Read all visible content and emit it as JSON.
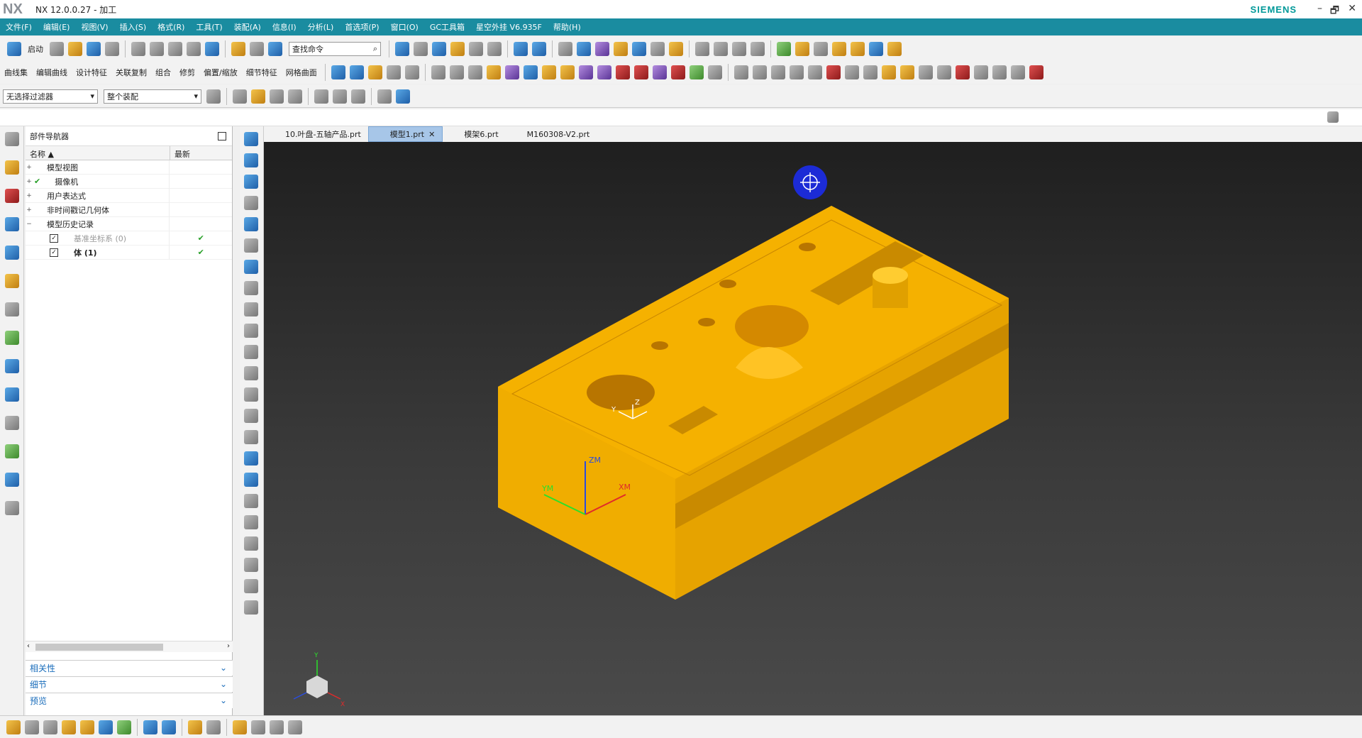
{
  "app": {
    "logo": "NX",
    "title": "NX 12.0.0.27 - 加工",
    "brand": "SIEMENS",
    "win_min": "–",
    "win_restore": "🗗",
    "win_close": "✕"
  },
  "menu": [
    "文件(F)",
    "编辑(E)",
    "视图(V)",
    "插入(S)",
    "格式(R)",
    "工具(T)",
    "装配(A)",
    "信息(I)",
    "分析(L)",
    "首选项(P)",
    "窗口(O)",
    "GC工具箱",
    "星空外挂 V6.935F",
    "帮助(H)"
  ],
  "toolbar1": {
    "start_label": "启动",
    "search_placeholder": "查找命令"
  },
  "toolbar2": {
    "items": [
      "曲线集",
      "编辑曲线",
      "设计特征",
      "关联复制",
      "组合",
      "修剪",
      "偏置/缩放",
      "细节特征",
      "网格曲面"
    ]
  },
  "toolbar3": {
    "filter": "无选择过滤器",
    "scope": "整个装配"
  },
  "navigator": {
    "title": "部件导航器",
    "col_name": "名称",
    "col_latest": "最新",
    "rows": [
      {
        "label": "模型视图",
        "latest": ""
      },
      {
        "label": "摄像机",
        "latest": ""
      },
      {
        "label": "用户表达式",
        "latest": ""
      },
      {
        "label": "非时间戳记几何体",
        "latest": ""
      },
      {
        "label": "模型历史记录",
        "latest": ""
      },
      {
        "label": "基准坐标系 (0)",
        "latest": "✔"
      },
      {
        "label": "体 (1)",
        "latest": "✔"
      }
    ],
    "panels": [
      "相关性",
      "细节",
      "预览"
    ]
  },
  "tabs": [
    {
      "label": "10.叶盘-五轴产品.prt"
    },
    {
      "label": "模型1.prt",
      "active": true
    },
    {
      "label": "模架6.prt"
    },
    {
      "label": "M160308-V2.prt"
    }
  ],
  "viewport": {
    "axes": {
      "zm": "ZM",
      "xm": "XM",
      "ym": "YM",
      "z": "Z",
      "y": "Y",
      "x": "X"
    },
    "part_color": "#f5b100"
  }
}
